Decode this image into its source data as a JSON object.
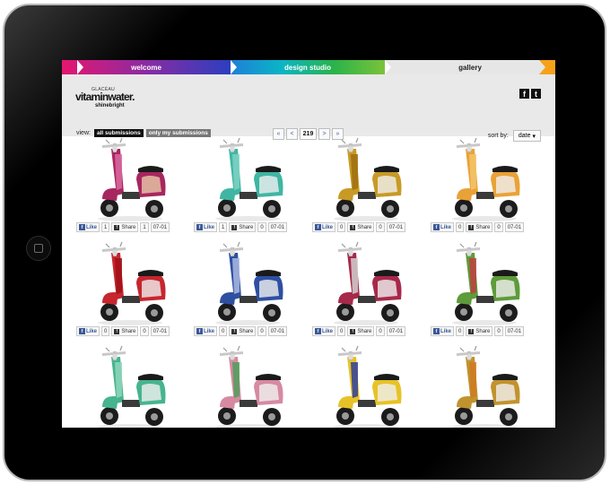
{
  "nav": {
    "tabs": [
      {
        "label": "welcome"
      },
      {
        "label": "design studio"
      },
      {
        "label": "gallery"
      }
    ],
    "end_color": "#f5a21a"
  },
  "brand": {
    "logo_small": "GLACÉAU",
    "logo_main": "vitaminwater.",
    "logo_sub": "shinebright"
  },
  "social_icons": [
    {
      "name": "facebook-icon",
      "glyph": "f"
    },
    {
      "name": "twitter-icon",
      "glyph": "t"
    }
  ],
  "filter": {
    "label": "view:",
    "options": [
      "all submissions",
      "only my submissions"
    ],
    "selected": "all submissions"
  },
  "pagination": {
    "first": "«",
    "prev": "<",
    "current": "219",
    "next": ">",
    "last": "»"
  },
  "sort": {
    "label": "sort by:",
    "value": "date"
  },
  "share_labels": {
    "like": "Like",
    "share": "Share"
  },
  "gallery": [
    {
      "primary": "#a8265f",
      "accent": "#e7c9a8",
      "pattern": "#d96aa0",
      "like_count": "1",
      "share_count": "1",
      "date": "07-01"
    },
    {
      "primary": "#3fb6a3",
      "accent": "#f0f0f0",
      "pattern": "#7fd2c3",
      "like_count": "1",
      "share_count": "0",
      "date": "07-01"
    },
    {
      "primary": "#c89a25",
      "accent": "#f0f0f0",
      "pattern": "#a06f10",
      "like_count": "0",
      "share_count": "0",
      "date": "07-01"
    },
    {
      "primary": "#e9a237",
      "accent": "#f0f0f0",
      "pattern": "#f3c46a",
      "like_count": "0",
      "share_count": "0",
      "date": "07-01"
    },
    {
      "primary": "#c6262e",
      "accent": "#f0f0f0",
      "pattern": "#a01018",
      "like_count": "0",
      "share_count": "0",
      "date": "07-01"
    },
    {
      "primary": "#2e4fa2",
      "accent": "#f0f0f0",
      "pattern": "#aab9e0",
      "like_count": "0",
      "share_count": "0",
      "date": "07-01"
    },
    {
      "primary": "#a7294a",
      "accent": "#f0f0f0",
      "pattern": "#d0d0d0",
      "like_count": "0",
      "share_count": "0",
      "date": "07-01"
    },
    {
      "primary": "#5e9b3a",
      "accent": "#f0f0f0",
      "pattern": "#c04040",
      "like_count": "0",
      "share_count": "0",
      "date": "07-01"
    },
    {
      "primary": "#46b48e",
      "accent": "#f0f0f0",
      "pattern": "#8fd6bc",
      "like_count": "",
      "share_count": "",
      "date": ""
    },
    {
      "primary": "#d68aa2",
      "accent": "#f0f0f0",
      "pattern": "#4d9e5a",
      "like_count": "",
      "share_count": "",
      "date": ""
    },
    {
      "primary": "#e7c227",
      "accent": "#f0f0f0",
      "pattern": "#2d3e9c",
      "like_count": "",
      "share_count": "",
      "date": ""
    },
    {
      "primary": "#c1932e",
      "accent": "#f0f0f0",
      "pattern": "#cf7a22",
      "like_count": "",
      "share_count": "",
      "date": ""
    }
  ]
}
